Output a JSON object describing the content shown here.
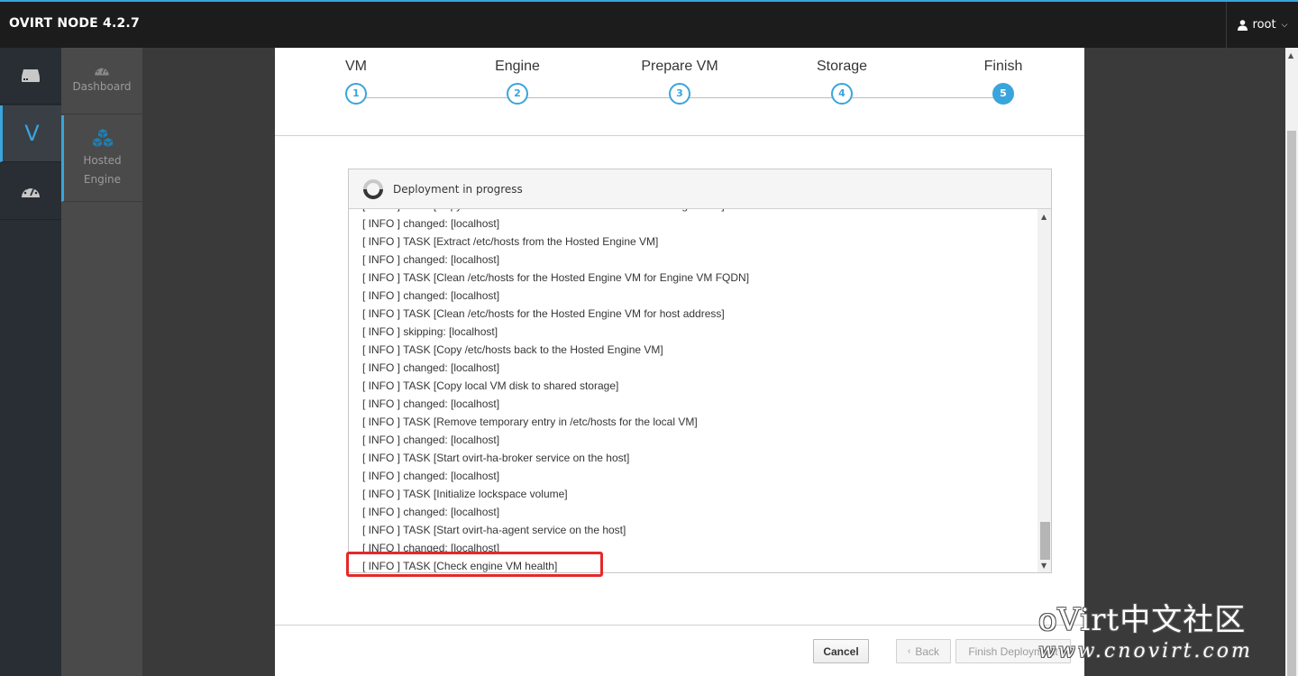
{
  "topbar": {
    "brand": "OVIRT NODE 4.2.7",
    "user": "root",
    "user_icon": "user-icon",
    "caret_icon": "chevron-down-icon"
  },
  "vnav": {
    "items": [
      {
        "icon": "server-icon",
        "label": ""
      },
      {
        "icon": "virtualization-v-icon",
        "label": "V"
      },
      {
        "icon": "dashboard-gauge-icon",
        "label": ""
      }
    ]
  },
  "snav": {
    "items": [
      {
        "label": "Dashboard",
        "icon": "dashboard-gauge-icon"
      },
      {
        "label": "Hosted Engine",
        "icon": "cubes-icon"
      }
    ]
  },
  "wizard": {
    "steps": [
      {
        "label": "VM",
        "number": "1"
      },
      {
        "label": "Engine",
        "number": "2"
      },
      {
        "label": "Prepare VM",
        "number": "3"
      },
      {
        "label": "Storage",
        "number": "4"
      },
      {
        "label": "Finish",
        "number": "5"
      }
    ],
    "active_step": 5,
    "accent_color": "#39a5dc"
  },
  "deployment": {
    "status": "Deployment in progress",
    "log": [
      "[ INFO ] TASK [Copy /etc/hosts from the local VM to the Hosted Engine VM]",
      "[ INFO ] changed: [localhost]",
      "[ INFO ] TASK [Extract /etc/hosts from the Hosted Engine VM]",
      "[ INFO ] changed: [localhost]",
      "[ INFO ] TASK [Clean /etc/hosts for the Hosted Engine VM for Engine VM FQDN]",
      "[ INFO ] changed: [localhost]",
      "[ INFO ] TASK [Clean /etc/hosts for the Hosted Engine VM for host address]",
      "[ INFO ] skipping: [localhost]",
      "[ INFO ] TASK [Copy /etc/hosts back to the Hosted Engine VM]",
      "[ INFO ] changed: [localhost]",
      "[ INFO ] TASK [Copy local VM disk to shared storage]",
      "[ INFO ] changed: [localhost]",
      "[ INFO ] TASK [Remove temporary entry in /etc/hosts for the local VM]",
      "[ INFO ] changed: [localhost]",
      "[ INFO ] TASK [Start ovirt-ha-broker service on the host]",
      "[ INFO ] changed: [localhost]",
      "[ INFO ] TASK [Initialize lockspace volume]",
      "[ INFO ] changed: [localhost]",
      "[ INFO ] TASK [Start ovirt-ha-agent service on the host]",
      "[ INFO ] changed: [localhost]",
      "[ INFO ] TASK [Check engine VM health]"
    ],
    "highlight_color": "#e62828"
  },
  "footer": {
    "cancel": "Cancel",
    "back": "Back",
    "back_icon": "chevron-left-icon",
    "finish": "Finish Deployment"
  },
  "watermark": {
    "line1": "oVirt中文社区",
    "line2": "www.cnovirt.com"
  }
}
